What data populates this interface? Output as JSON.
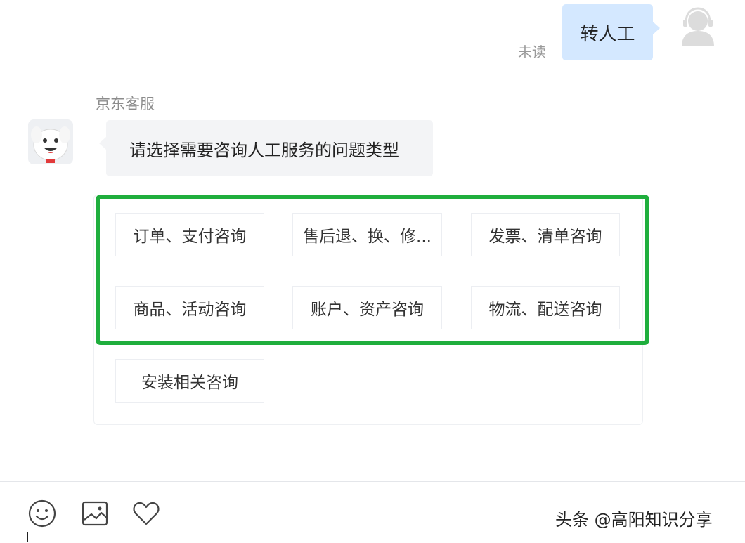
{
  "chat": {
    "outgoing": {
      "text": "转人工",
      "status": "未读"
    },
    "agent": {
      "name": "京东客服",
      "message": "请选择需要咨询人工服务的问题类型"
    },
    "options": [
      {
        "label": "订单、支付咨询"
      },
      {
        "label": "售后退、换、修..."
      },
      {
        "label": "发票、清单咨询"
      },
      {
        "label": "商品、活动咨询"
      },
      {
        "label": "账户、资产咨询"
      },
      {
        "label": "物流、配送咨询"
      },
      {
        "label": "安装相关咨询"
      }
    ]
  },
  "toolbar": {
    "icons": [
      "emoji-icon",
      "image-icon",
      "heart-icon"
    ]
  },
  "watermark": "头条 @高阳知识分享",
  "colors": {
    "highlight": "#1fae3d",
    "user_bubble": "#d4e8ff",
    "agent_bubble": "#f3f4f6"
  }
}
